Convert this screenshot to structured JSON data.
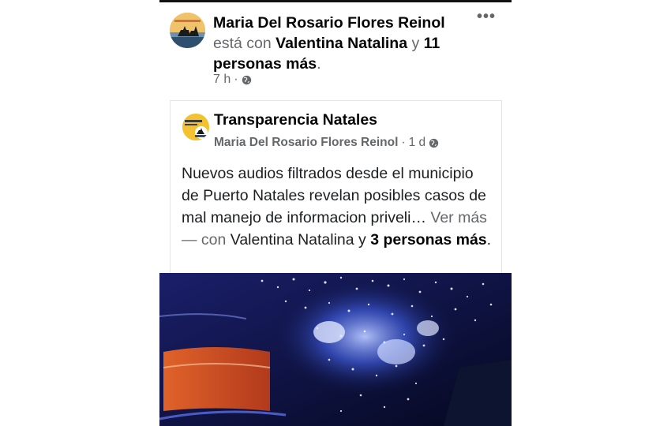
{
  "post": {
    "author": "Maria Del Rosario Flores Reinol",
    "with_prefix": "está con",
    "tagged_person": "Valentina Natalina",
    "conjunction": "y",
    "others": "11 personas más",
    "period": ".",
    "time": "7 h",
    "separator": "·",
    "privacy_icon": "globe-icon",
    "more_icon": "more-options-icon",
    "more_label": "•••"
  },
  "shared_post": {
    "page_name": "Transparencia Natales",
    "posted_by": "Maria Del Rosario Flores Reinol",
    "separator": "·",
    "time": "1 d",
    "privacy_icon": "globe-icon",
    "text": "Nuevos audios filtrados desde el municipio de Puerto Natales revelan posibles casos de mal manejo de informacion priveli…",
    "see_more": "Ver más",
    "with_text": "— con",
    "tagged_person": "Valentina Natalina",
    "conjunction": "y",
    "others": "3 personas más",
    "period": "."
  },
  "colors": {
    "primary_text": "#050505",
    "secondary_text": "#65676b",
    "card_border": "#e4e6eb",
    "video_background": "#0a0f3a"
  }
}
